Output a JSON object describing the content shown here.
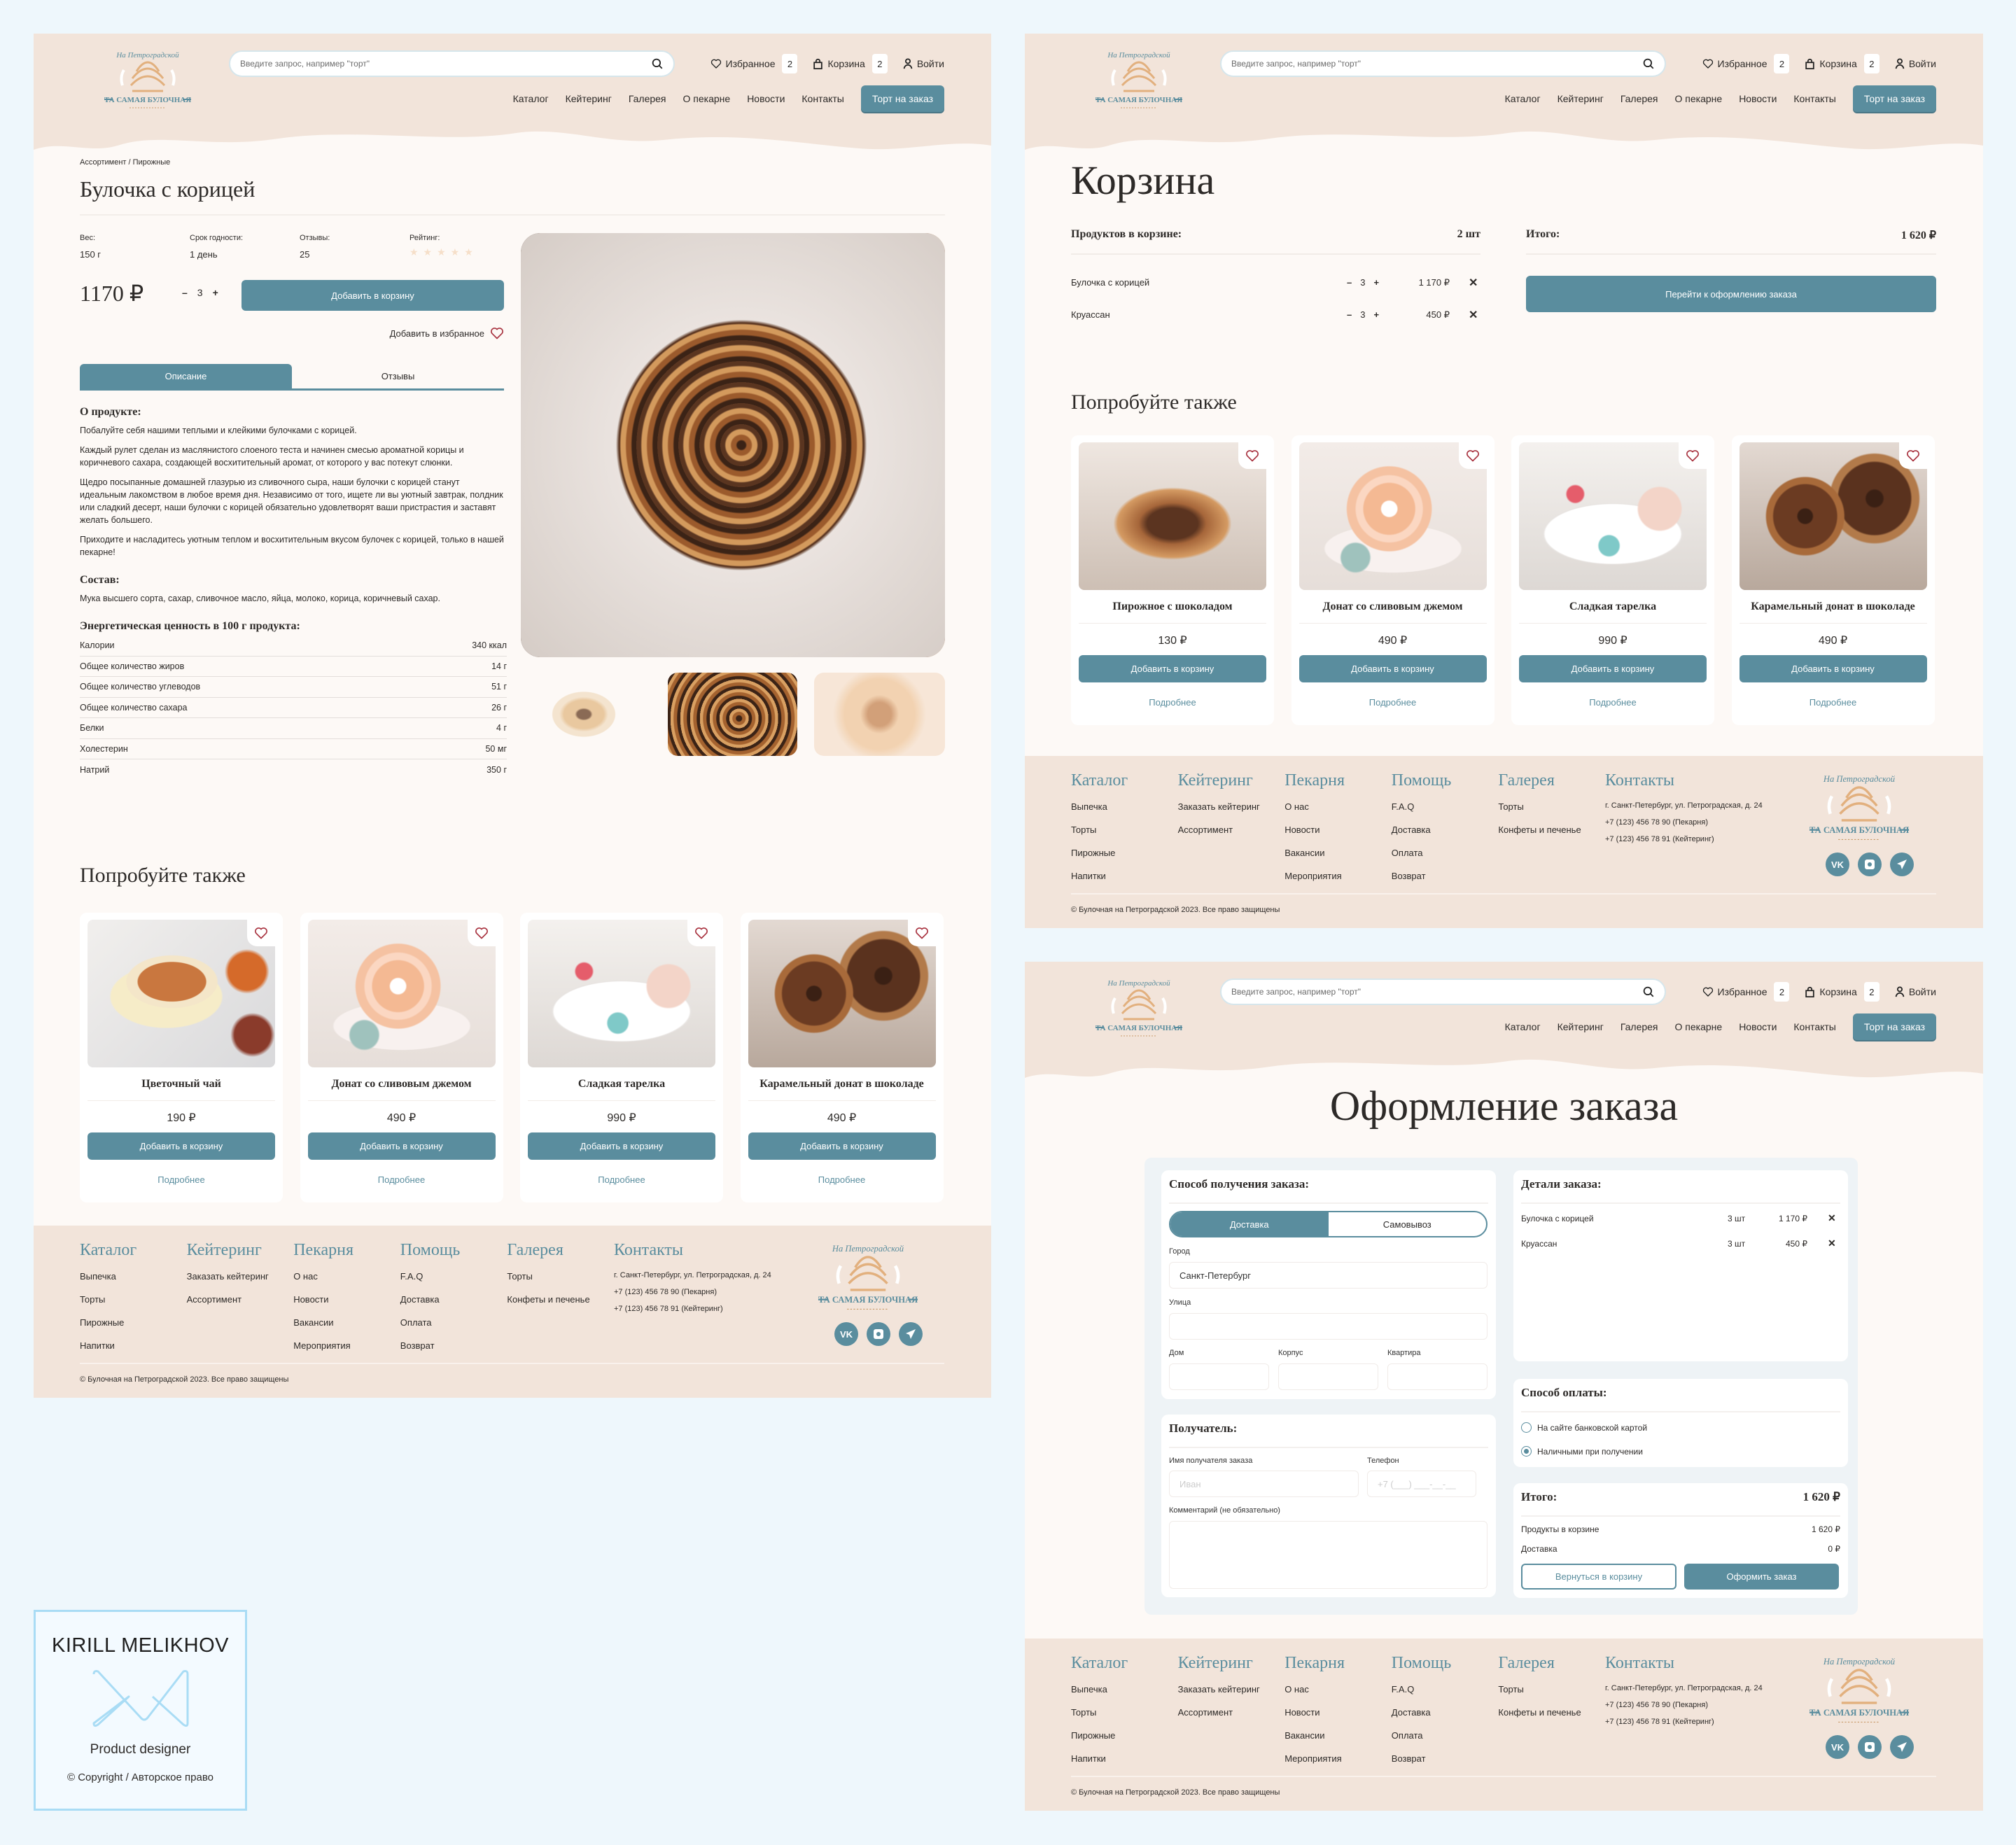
{
  "header": {
    "logo_arc": "На Петроградской",
    "logo_name": "ТА САМАЯ БУЛОЧНАЯ",
    "search_placeholder": "Введите запрос, например \"торт\"",
    "favorites_label": "Избранное",
    "favorites_count": "2",
    "cart_label": "Корзина",
    "cart_count": "2",
    "login_label": "Войти",
    "nav": [
      "Каталог",
      "Кейтеринг",
      "Галерея",
      "О пекарне",
      "Новости",
      "Контакты"
    ],
    "cta": "Торт на заказ"
  },
  "product_page": {
    "breadcrumb": "Ассортимент / Пирожные",
    "title": "Булочка с корицей",
    "specs": [
      {
        "label": "Вес:",
        "value": "150 г"
      },
      {
        "label": "Срок годности:",
        "value": "1 день"
      },
      {
        "label": "Отзывы:",
        "value": "25"
      }
    ],
    "rating_label": "Рейтинг:",
    "rating": {
      "value": 0,
      "max": 5
    },
    "price": "1170 ₽",
    "qty": "3",
    "add_to_cart": "Добавить в корзину",
    "add_to_favorites": "Добавить в избранное",
    "tabs": [
      "Описание",
      "Отзывы"
    ],
    "about_title": "О продукте:",
    "about_paragraphs": [
      "Побалуйте себя нашими теплыми и клейкими булочками с корицей.",
      "Каждый рулет сделан из маслянистого слоеного теста и начинен смесью ароматной корицы и коричневого сахара, создающей восхитительный аромат, от которого у вас потекут слюнки.",
      "Щедро посыпанные домашней глазурью из сливочного сыра, наши булочки с корицей станут идеальным лакомством в любое время дня. Независимо от того, ищете ли вы уютный завтрак, полдник или сладкий десерт, наши булочки с корицей обязательно удовлетворят ваши пристрастия и заставят желать большего.",
      "Приходите и насладитесь уютным теплом и восхитительным вкусом булочек с корицей, только в нашей пекарне!"
    ],
    "composition_title": "Состав:",
    "composition_text": "Мука высшего сорта, сахар, сливочное масло, яйца, молоко, корица, коричневый сахар.",
    "nutrition_title": "Энергетическая ценность в 100 г продукта:",
    "nutrition": [
      {
        "name": "Калории",
        "value": "340 ккал"
      },
      {
        "name": "Общее количество жиров",
        "value": "14 г"
      },
      {
        "name": "Общее количество углеводов",
        "value": "51 г"
      },
      {
        "name": "Общее количество сахара",
        "value": "26 г"
      },
      {
        "name": "Белки",
        "value": "4 г"
      },
      {
        "name": "Холестерин",
        "value": "50 мг"
      },
      {
        "name": "Натрий",
        "value": "350 г"
      }
    ],
    "recommendations_title": "Попробуйте также",
    "recommendations": [
      {
        "name": "Цветочный чай",
        "price": "190 ₽",
        "image": "tea"
      },
      {
        "name": "Донат со сливовым джемом",
        "price": "490 ₽",
        "image": "donut"
      },
      {
        "name": "Сладкая тарелка",
        "price": "990 ₽",
        "image": "plate"
      },
      {
        "name": "Карамельный донат в шоколаде",
        "price": "490 ₽",
        "image": "choco"
      }
    ]
  },
  "card_labels": {
    "add": "Добавить в корзину",
    "more": "Подробнее"
  },
  "cart_page": {
    "title": "Корзина",
    "count_label": "Продуктов в корзине:",
    "count_value": "2 шт",
    "total_label": "Итого:",
    "total_value": "1 620 ₽",
    "items": [
      {
        "name": "Булочка с корицей",
        "qty": "3",
        "price": "1 170 ₽"
      },
      {
        "name": "Круассан",
        "qty": "3",
        "price": "450 ₽"
      }
    ],
    "checkout_button": "Перейти к оформлению заказа",
    "recommendations_title": "Попробуйте также",
    "recommendations": [
      {
        "name": "Пирожное с шоколадом",
        "price": "130 ₽",
        "image": "pastry"
      },
      {
        "name": "Донат со сливовым джемом",
        "price": "490 ₽",
        "image": "donut"
      },
      {
        "name": "Сладкая тарелка",
        "price": "990 ₽",
        "image": "plate"
      },
      {
        "name": "Карамельный донат в шоколаде",
        "price": "490 ₽",
        "image": "choco"
      }
    ]
  },
  "checkout_page": {
    "title": "Оформление заказа",
    "delivery_title": "Способ получения заказа:",
    "delivery_options": [
      "Доставка",
      "Самовывоз"
    ],
    "city_label": "Город",
    "city_value": "Санкт-Петербург",
    "street_label": "Улица",
    "house_label": "Дом",
    "building_label": "Корпус",
    "apartment_label": "Квартира",
    "recipient_title": "Получатель:",
    "name_label": "Имя получателя заказа",
    "name_placeholder": "Иван",
    "phone_label": "Телефон",
    "phone_placeholder": "+7 (___) ___-__-__",
    "comment_label": "Комментарий (не обязательно)",
    "details_title": "Детали заказа:",
    "details": [
      {
        "name": "Булочка с корицей",
        "qty": "3 шт",
        "price": "1 170 ₽"
      },
      {
        "name": "Круассан",
        "qty": "3 шт",
        "price": "450 ₽"
      }
    ],
    "payment_title": "Способ оплаты:",
    "payment_options": [
      "На сайте банковской картой",
      "Наличными при получении"
    ],
    "payment_selected": 1,
    "total_label": "Итого:",
    "total_value": "1 620 ₽",
    "products_label": "Продукты в корзине",
    "products_value": "1 620 ₽",
    "delivery_label": "Доставка",
    "delivery_value": "0 ₽",
    "back_button": "Вернуться в корзину",
    "submit_button": "Оформить заказ"
  },
  "footer": {
    "columns": [
      {
        "title": "Каталог",
        "items": [
          "Выпечка",
          "Торты",
          "Пирожные",
          "Напитки"
        ]
      },
      {
        "title": "Кейтеринг",
        "items": [
          "Заказать кейтеринг",
          "Ассортимент"
        ]
      },
      {
        "title": "Пекарня",
        "items": [
          "О нас",
          "Новости",
          "Вакансии",
          "Мероприятия"
        ]
      },
      {
        "title": "Помощь",
        "items": [
          "F.A.Q",
          "Доставка",
          "Оплата",
          "Возврат"
        ]
      },
      {
        "title": "Галерея",
        "items": [
          "Торты",
          "Конфеты и печенье"
        ]
      }
    ],
    "contacts_title": "Контакты",
    "contacts": [
      "г. Санкт-Петербург, ул. Петроградская, д. 24",
      "+7 (123) 456 78 90 (Пекарня)",
      "+7 (123) 456 78 91 (Кейтеринг)"
    ],
    "copyright": "© Булочная на Петроградской 2023. Все право защищены"
  },
  "branding": {
    "name": "KIRILL MELIKHOV",
    "role": "Product designer",
    "copyright": "© Copyright / Авторское право"
  },
  "colors": {
    "accent": "#5a8d9e",
    "header_bg": "#f2e4da",
    "page_bg": "#fdf9f6",
    "heart": "#a8323f"
  }
}
